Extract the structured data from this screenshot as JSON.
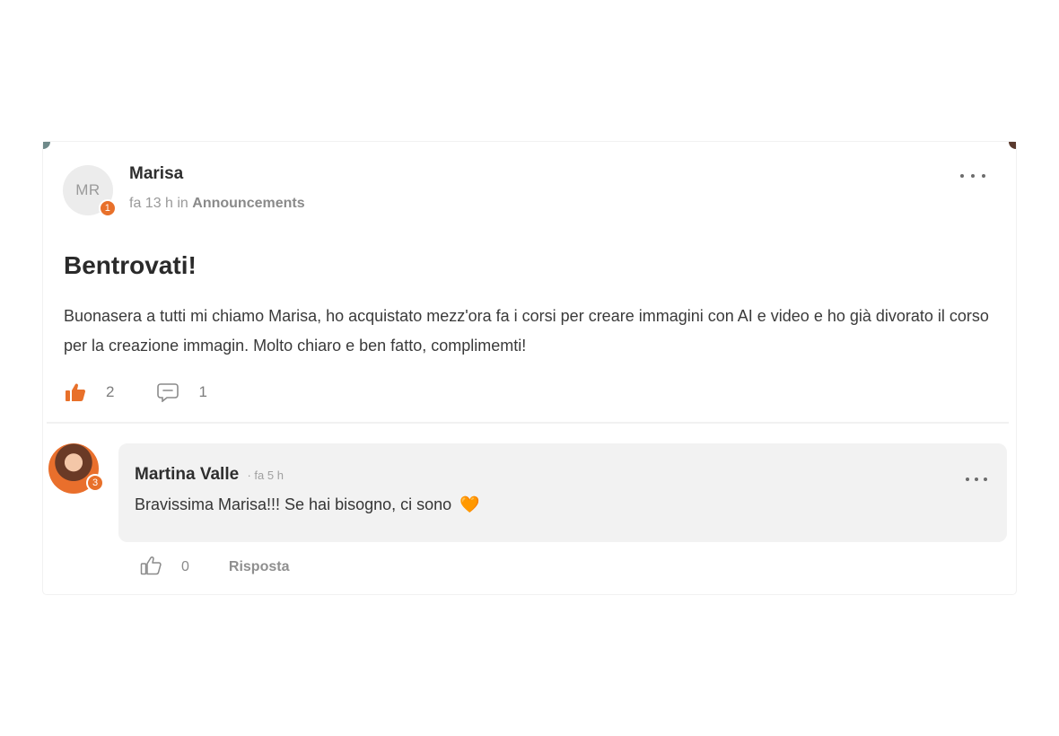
{
  "post": {
    "author_initials": "MR",
    "author_name": "Marisa",
    "author_level": "1",
    "time_prefix": "fa 13 h in",
    "category": "Announcements",
    "title": "Bentrovati!",
    "body": "Buonasera a tutti mi chiamo Marisa, ho acquistato mezz'ora fa i corsi per creare immagini con AI e video e ho già divorato il corso per la creazione immagin. Molto chiaro e ben fatto, complimemti!",
    "likes": "2",
    "comments": "1",
    "like_icon": "thumbs-up-filled-icon",
    "comment_icon": "comment-icon"
  },
  "comment": {
    "author_name": "Martina Valle",
    "time": "· fa 5 h",
    "author_level": "3",
    "text": "Bravissima Marisa!!! Se hai bisogno, ci sono",
    "emoji": "🧡",
    "likes": "0",
    "reply_label": "Risposta",
    "like_icon": "thumbs-up-outline-icon"
  },
  "colors": {
    "accent": "#e8702a",
    "bubble_bg": "#f2f2f2",
    "meta_text": "#9a9a9a"
  }
}
